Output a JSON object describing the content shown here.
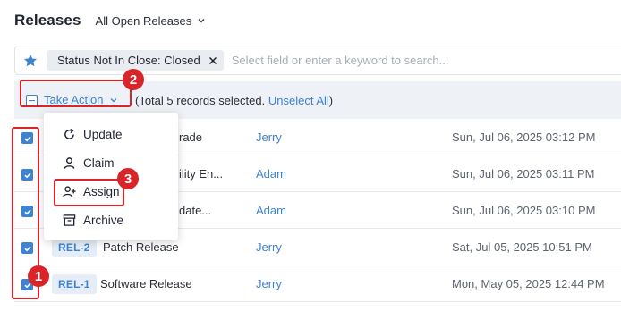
{
  "header": {
    "title": "Releases",
    "view_label": "All Open Releases"
  },
  "filter": {
    "chip_label": "Status Not In Close: Closed",
    "placeholder": "Select field or enter a keyword to search..."
  },
  "action_bar": {
    "take_action_label": "Take Action",
    "records_note": "(Total 5 records selected. ",
    "unselect_label": "Unselect All",
    "records_note_close": ")"
  },
  "menu": {
    "items": [
      {
        "label": "Update",
        "icon": "refresh-icon"
      },
      {
        "label": "Claim",
        "icon": "user-icon"
      },
      {
        "label": "Assign",
        "icon": "user-plus-icon"
      },
      {
        "label": "Archive",
        "icon": "archive-icon"
      }
    ]
  },
  "rows": [
    {
      "id": "",
      "name": "rade",
      "owner": "Jerry",
      "date": "Sun, Jul 06, 2025 03:12 PM",
      "checked": true
    },
    {
      "id": "",
      "name": "ility En...",
      "owner": "Adam",
      "date": "Sun, Jul 06, 2025 03:11 PM",
      "checked": true
    },
    {
      "id": "",
      "name": "date...",
      "owner": "Adam",
      "date": "Sun, Jul 06, 2025 03:10 PM",
      "checked": true
    },
    {
      "id": "REL-2",
      "name": "Patch Release",
      "owner": "Jerry",
      "date": "Sat, Jul 05, 2025 10:51 PM",
      "checked": true
    },
    {
      "id": "REL-1",
      "name": "Software Release",
      "owner": "Jerry",
      "date": "Mon, May 05, 2025 12:44 PM",
      "checked": true
    }
  ],
  "annotations": {
    "badge_1": "1",
    "badge_2": "2",
    "badge_3": "3"
  },
  "colors": {
    "accent": "#3e82d4",
    "highlight": "#d9242a"
  }
}
